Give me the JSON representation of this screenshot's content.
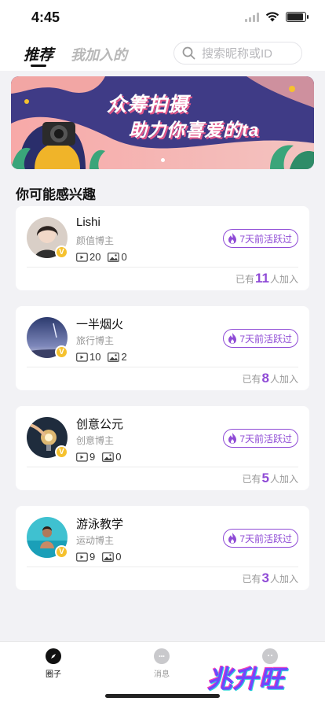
{
  "status_bar": {
    "time": "4:45",
    "battery_level": 0.9
  },
  "header": {
    "tabs": [
      {
        "label": "推荐",
        "active": true
      },
      {
        "label": "我加入的",
        "active": false
      }
    ],
    "search": {
      "placeholder": "搜索昵称或ID",
      "icon": "search-icon"
    }
  },
  "banner": {
    "line1": "众筹拍摄",
    "line2": "助力你喜爱的ta",
    "slide_count": 1,
    "current_slide": 1
  },
  "section_title": "你可能感兴趣",
  "cards": [
    {
      "name": "Lishi",
      "category": "颜值博主",
      "videos": "20",
      "photos": "0",
      "active": "7天前活跃过",
      "joined_prefix": "已有",
      "joined_count": "11",
      "joined_suffix": "人加入",
      "verified": "V"
    },
    {
      "name": "一半烟火",
      "category": "旅行博主",
      "videos": "10",
      "photos": "2",
      "active": "7天前活跃过",
      "joined_prefix": "已有",
      "joined_count": "8",
      "joined_suffix": "人加入",
      "verified": "V"
    },
    {
      "name": "创意公元",
      "category": "创意博主",
      "videos": "9",
      "photos": "0",
      "active": "7天前活跃过",
      "joined_prefix": "已有",
      "joined_count": "5",
      "joined_suffix": "人加入",
      "verified": "V"
    },
    {
      "name": "游泳教学",
      "category": "运动博主",
      "videos": "9",
      "photos": "0",
      "active": "7天前活跃过",
      "joined_prefix": "已有",
      "joined_count": "3",
      "joined_suffix": "人加入",
      "verified": "V"
    }
  ],
  "bottom_nav": [
    {
      "label": "圈子",
      "icon": "compass-icon",
      "active": true
    },
    {
      "label": "消息",
      "icon": "message-icon",
      "active": false
    },
    {
      "label": "",
      "icon": "smiley-icon",
      "active": false
    }
  ],
  "watermark": "兆升旺",
  "colors": {
    "accent": "#8f4bd6",
    "badge": "#f5c12e",
    "banner_bg": "#3f3b86"
  }
}
